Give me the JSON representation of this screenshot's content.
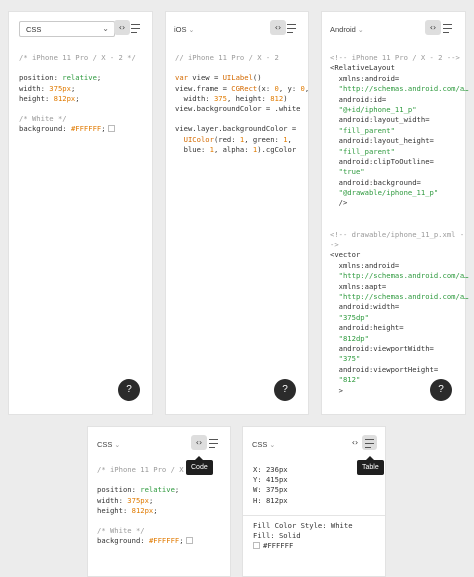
{
  "panel_css": {
    "selector": "CSS",
    "comment_device": "/* iPhone 11 Pro / X - 2 */",
    "lines": {
      "position_key": "position: ",
      "position_val": "relative",
      "position_end": ";",
      "width_key": "width: ",
      "width_val": "375px",
      "width_end": ";",
      "height_key": "height: ",
      "height_val": "812px",
      "height_end": ";",
      "comment_color": "/* White */",
      "bg_key": "background: ",
      "bg_val": "#FFFFFF",
      "bg_end": ";"
    },
    "help": "?"
  },
  "panel_ios": {
    "selector": "iOS",
    "comment_device": "// iPhone 11 Pro / X - 2",
    "l1_kw": "var",
    "l1_rest": " view = ",
    "l1_call": "UILabel",
    "l1_end": "()",
    "l2_a": "view.frame = ",
    "l2_call": "CGRect",
    "l2_b": "(x: ",
    "l2_x": "0",
    "l2_c": ", y: ",
    "l2_y": "0",
    "l2_d": ",",
    "l3_a": "  width: ",
    "l3_w": "375",
    "l3_b": ", height: ",
    "l3_h": "812",
    "l3_c": ")",
    "l4": "view.backgroundColor = .white",
    "l5": "view.layer.backgroundColor =",
    "l6_call": "UIColor",
    "l6_a": "(red: ",
    "l6_r": "1",
    "l6_b": ", green: ",
    "l6_g": "1",
    "l6_c": ",",
    "l7_a": "  blue: ",
    "l7_b1": "1",
    "l7_b": ", alpha: ",
    "l7_al": "1",
    "l7_c": ").cgColor",
    "help": "?"
  },
  "panel_android": {
    "selector": "Android",
    "lines": [
      {
        "t": "<!-- iPhone 11 Pro / X - 2 -->",
        "c": "cm"
      },
      {
        "t": "<RelativeLayout",
        "c": ""
      },
      {
        "t": "  xmlns:android=",
        "c": ""
      },
      {
        "t": "  \"http://schemas.android.com/a…",
        "c": "gr"
      },
      {
        "t": "  android:id=",
        "c": ""
      },
      {
        "t": "  \"@+id/iphone_11_p\"",
        "c": "gr"
      },
      {
        "t": "  android:layout_width=",
        "c": ""
      },
      {
        "t": "  \"fill_parent\"",
        "c": "gr"
      },
      {
        "t": "  android:layout_height=",
        "c": ""
      },
      {
        "t": "  \"fill_parent\"",
        "c": "gr"
      },
      {
        "t": "  android:clipToOutline=",
        "c": ""
      },
      {
        "t": "  \"true\"",
        "c": "gr"
      },
      {
        "t": "  android:background=",
        "c": ""
      },
      {
        "t": "  \"@drawable/iphone_11_p\"",
        "c": "gr"
      },
      {
        "t": "  />",
        "c": ""
      },
      {
        "t": "",
        "c": ""
      },
      {
        "t": "",
        "c": ""
      },
      {
        "t": "<!-- drawable/iphone_11_p.xml -",
        "c": "cm"
      },
      {
        "t": "->",
        "c": "cm"
      },
      {
        "t": "<vector",
        "c": ""
      },
      {
        "t": "  xmlns:android=",
        "c": ""
      },
      {
        "t": "  \"http://schemas.android.com/a…",
        "c": "gr"
      },
      {
        "t": "  xmlns:aapt=",
        "c": ""
      },
      {
        "t": "  \"http://schemas.android.com/a…",
        "c": "gr"
      },
      {
        "t": "  android:width=",
        "c": ""
      },
      {
        "t": "  \"375dp\"",
        "c": "gr"
      },
      {
        "t": "  android:height=",
        "c": ""
      },
      {
        "t": "  \"812dp\"",
        "c": "gr"
      },
      {
        "t": "  android:viewportWidth=",
        "c": ""
      },
      {
        "t": "  \"375\"",
        "c": "gr"
      },
      {
        "t": "  android:viewportHeight=",
        "c": ""
      },
      {
        "t": "  \"812\"",
        "c": "gr"
      },
      {
        "t": "  >",
        "c": ""
      }
    ],
    "help": "?"
  },
  "panel_code": {
    "selector": "CSS",
    "tooltip": "Code",
    "comment_device": "/* iPhone 11 Pro / X",
    "position_key": "position: ",
    "position_val": "relative",
    "position_end": ";",
    "width_key": "width: ",
    "width_val": "375px",
    "width_end": ";",
    "height_key": "height: ",
    "height_val": "812px",
    "height_end": ";",
    "comment_color": "/* White */",
    "bg_key": "background: ",
    "bg_val": "#FFFFFF",
    "bg_end": ";"
  },
  "panel_table": {
    "selector": "CSS",
    "tooltip": "Table",
    "x": "X: 236px",
    "y": "Y: 415px",
    "w": "W: 375px",
    "h": "H: 812px",
    "fill_style": "Fill Color Style: White",
    "fill": "Fill: Solid",
    "hex": "#FFFFFF"
  },
  "colors": {
    "accent_number": "#e07a00",
    "string": "#2e9a3e",
    "comment": "#9a9a9a"
  }
}
